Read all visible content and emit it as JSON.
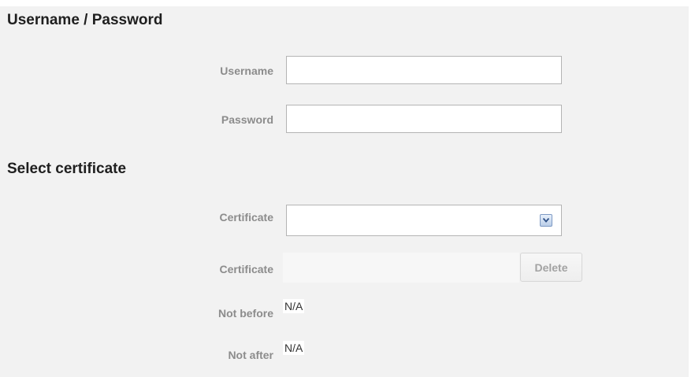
{
  "credentials": {
    "title": "Username / Password",
    "username_label": "Username",
    "username_value": "",
    "password_label": "Password",
    "password_value": ""
  },
  "certificate": {
    "title": "Select certificate",
    "select_label": "Certificate",
    "select_value": "",
    "select_icon": "chevron-down-icon",
    "current_label": "Certificate",
    "current_value": "",
    "delete_label": "Delete",
    "not_before_label": "Not before",
    "not_before_value": "N/A",
    "not_after_label": "Not after",
    "not_after_value": "N/A"
  },
  "colors": {
    "panel_background": "#f2f2f2",
    "label_text": "#8c8c8c",
    "heading_text": "#1f1f1f",
    "disabled_button_text": "#a3a3a3"
  }
}
